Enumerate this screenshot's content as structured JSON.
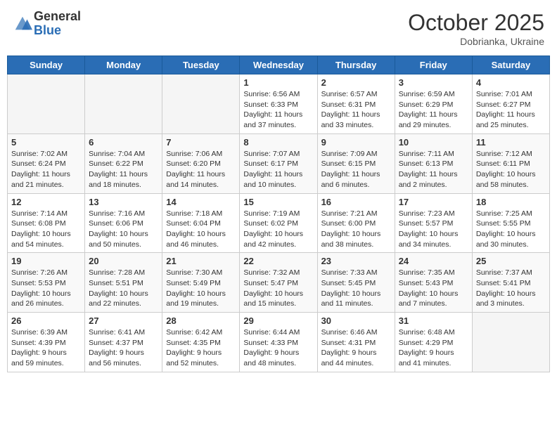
{
  "header": {
    "logo_general": "General",
    "logo_blue": "Blue",
    "month_title": "October 2025",
    "subtitle": "Dobrianka, Ukraine"
  },
  "weekdays": [
    "Sunday",
    "Monday",
    "Tuesday",
    "Wednesday",
    "Thursday",
    "Friday",
    "Saturday"
  ],
  "weeks": [
    [
      {
        "day": "",
        "sunrise": "",
        "sunset": "",
        "daylight": ""
      },
      {
        "day": "",
        "sunrise": "",
        "sunset": "",
        "daylight": ""
      },
      {
        "day": "",
        "sunrise": "",
        "sunset": "",
        "daylight": ""
      },
      {
        "day": "1",
        "sunrise": "Sunrise: 6:56 AM",
        "sunset": "Sunset: 6:33 PM",
        "daylight": "Daylight: 11 hours and 37 minutes."
      },
      {
        "day": "2",
        "sunrise": "Sunrise: 6:57 AM",
        "sunset": "Sunset: 6:31 PM",
        "daylight": "Daylight: 11 hours and 33 minutes."
      },
      {
        "day": "3",
        "sunrise": "Sunrise: 6:59 AM",
        "sunset": "Sunset: 6:29 PM",
        "daylight": "Daylight: 11 hours and 29 minutes."
      },
      {
        "day": "4",
        "sunrise": "Sunrise: 7:01 AM",
        "sunset": "Sunset: 6:27 PM",
        "daylight": "Daylight: 11 hours and 25 minutes."
      }
    ],
    [
      {
        "day": "5",
        "sunrise": "Sunrise: 7:02 AM",
        "sunset": "Sunset: 6:24 PM",
        "daylight": "Daylight: 11 hours and 21 minutes."
      },
      {
        "day": "6",
        "sunrise": "Sunrise: 7:04 AM",
        "sunset": "Sunset: 6:22 PM",
        "daylight": "Daylight: 11 hours and 18 minutes."
      },
      {
        "day": "7",
        "sunrise": "Sunrise: 7:06 AM",
        "sunset": "Sunset: 6:20 PM",
        "daylight": "Daylight: 11 hours and 14 minutes."
      },
      {
        "day": "8",
        "sunrise": "Sunrise: 7:07 AM",
        "sunset": "Sunset: 6:17 PM",
        "daylight": "Daylight: 11 hours and 10 minutes."
      },
      {
        "day": "9",
        "sunrise": "Sunrise: 7:09 AM",
        "sunset": "Sunset: 6:15 PM",
        "daylight": "Daylight: 11 hours and 6 minutes."
      },
      {
        "day": "10",
        "sunrise": "Sunrise: 7:11 AM",
        "sunset": "Sunset: 6:13 PM",
        "daylight": "Daylight: 11 hours and 2 minutes."
      },
      {
        "day": "11",
        "sunrise": "Sunrise: 7:12 AM",
        "sunset": "Sunset: 6:11 PM",
        "daylight": "Daylight: 10 hours and 58 minutes."
      }
    ],
    [
      {
        "day": "12",
        "sunrise": "Sunrise: 7:14 AM",
        "sunset": "Sunset: 6:08 PM",
        "daylight": "Daylight: 10 hours and 54 minutes."
      },
      {
        "day": "13",
        "sunrise": "Sunrise: 7:16 AM",
        "sunset": "Sunset: 6:06 PM",
        "daylight": "Daylight: 10 hours and 50 minutes."
      },
      {
        "day": "14",
        "sunrise": "Sunrise: 7:18 AM",
        "sunset": "Sunset: 6:04 PM",
        "daylight": "Daylight: 10 hours and 46 minutes."
      },
      {
        "day": "15",
        "sunrise": "Sunrise: 7:19 AM",
        "sunset": "Sunset: 6:02 PM",
        "daylight": "Daylight: 10 hours and 42 minutes."
      },
      {
        "day": "16",
        "sunrise": "Sunrise: 7:21 AM",
        "sunset": "Sunset: 6:00 PM",
        "daylight": "Daylight: 10 hours and 38 minutes."
      },
      {
        "day": "17",
        "sunrise": "Sunrise: 7:23 AM",
        "sunset": "Sunset: 5:57 PM",
        "daylight": "Daylight: 10 hours and 34 minutes."
      },
      {
        "day": "18",
        "sunrise": "Sunrise: 7:25 AM",
        "sunset": "Sunset: 5:55 PM",
        "daylight": "Daylight: 10 hours and 30 minutes."
      }
    ],
    [
      {
        "day": "19",
        "sunrise": "Sunrise: 7:26 AM",
        "sunset": "Sunset: 5:53 PM",
        "daylight": "Daylight: 10 hours and 26 minutes."
      },
      {
        "day": "20",
        "sunrise": "Sunrise: 7:28 AM",
        "sunset": "Sunset: 5:51 PM",
        "daylight": "Daylight: 10 hours and 22 minutes."
      },
      {
        "day": "21",
        "sunrise": "Sunrise: 7:30 AM",
        "sunset": "Sunset: 5:49 PM",
        "daylight": "Daylight: 10 hours and 19 minutes."
      },
      {
        "day": "22",
        "sunrise": "Sunrise: 7:32 AM",
        "sunset": "Sunset: 5:47 PM",
        "daylight": "Daylight: 10 hours and 15 minutes."
      },
      {
        "day": "23",
        "sunrise": "Sunrise: 7:33 AM",
        "sunset": "Sunset: 5:45 PM",
        "daylight": "Daylight: 10 hours and 11 minutes."
      },
      {
        "day": "24",
        "sunrise": "Sunrise: 7:35 AM",
        "sunset": "Sunset: 5:43 PM",
        "daylight": "Daylight: 10 hours and 7 minutes."
      },
      {
        "day": "25",
        "sunrise": "Sunrise: 7:37 AM",
        "sunset": "Sunset: 5:41 PM",
        "daylight": "Daylight: 10 hours and 3 minutes."
      }
    ],
    [
      {
        "day": "26",
        "sunrise": "Sunrise: 6:39 AM",
        "sunset": "Sunset: 4:39 PM",
        "daylight": "Daylight: 9 hours and 59 minutes."
      },
      {
        "day": "27",
        "sunrise": "Sunrise: 6:41 AM",
        "sunset": "Sunset: 4:37 PM",
        "daylight": "Daylight: 9 hours and 56 minutes."
      },
      {
        "day": "28",
        "sunrise": "Sunrise: 6:42 AM",
        "sunset": "Sunset: 4:35 PM",
        "daylight": "Daylight: 9 hours and 52 minutes."
      },
      {
        "day": "29",
        "sunrise": "Sunrise: 6:44 AM",
        "sunset": "Sunset: 4:33 PM",
        "daylight": "Daylight: 9 hours and 48 minutes."
      },
      {
        "day": "30",
        "sunrise": "Sunrise: 6:46 AM",
        "sunset": "Sunset: 4:31 PM",
        "daylight": "Daylight: 9 hours and 44 minutes."
      },
      {
        "day": "31",
        "sunrise": "Sunrise: 6:48 AM",
        "sunset": "Sunset: 4:29 PM",
        "daylight": "Daylight: 9 hours and 41 minutes."
      },
      {
        "day": "",
        "sunrise": "",
        "sunset": "",
        "daylight": ""
      }
    ]
  ]
}
